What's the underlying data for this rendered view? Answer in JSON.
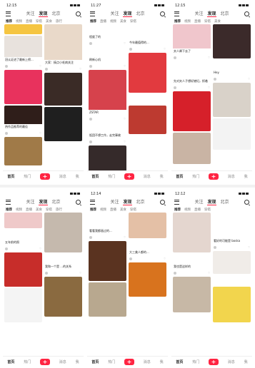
{
  "phones": [
    {
      "time": "12:15",
      "tabs": [
        "关注",
        "发现",
        "北京"
      ],
      "active_tab": "发现",
      "chips": [
        "推荐",
        "视频",
        "直播",
        "穿搭",
        "美食",
        "旅行"
      ],
      "bottom": [
        "首页",
        "热门",
        "+",
        "消息",
        "我"
      ],
      "left": [
        {
          "h": 14,
          "bg": "#f5c542",
          "cap": "",
          "user": ""
        },
        {
          "h": 30,
          "bg": "#e8e2dd",
          "cap": "冠认证进了最新上榜...",
          "user": ""
        },
        {
          "h": 48,
          "bg": "#e8325d",
          "cap": "",
          "user": ""
        },
        {
          "h": 26,
          "bg": "#2f1e1a",
          "cap": "热作品推荐的最佳",
          "user": ""
        },
        {
          "h": 40,
          "bg": "#a07a48",
          "cap": "",
          "user": ""
        }
      ],
      "right": [
        {
          "h": 50,
          "bg": "#e9d9c9",
          "cap": "大家：搞点小毛病关注",
          "user": ""
        },
        {
          "h": 46,
          "bg": "#3a2b26",
          "cap": "",
          "user": ""
        },
        {
          "h": 48,
          "bg": "#1f1f1f",
          "cap": "",
          "user": ""
        }
      ]
    },
    {
      "time": "11:27",
      "tabs": [
        "关注",
        "发现",
        "北京"
      ],
      "active_tab": "发现",
      "chips": [
        "推荐",
        "直播",
        "视频",
        "美食",
        "穿搭"
      ],
      "bottom": [
        "首页",
        "热门",
        "+",
        "消息",
        "我"
      ],
      "left": [
        {
          "h": 14,
          "bg": "#ffffff",
          "cap": "程度了的",
          "user": ""
        },
        {
          "h": 14,
          "bg": "#ffffff",
          "cap": "刷新心机",
          "user": ""
        },
        {
          "h": 56,
          "bg": "#d6424c",
          "cap": "ZSTAR",
          "user": ""
        },
        {
          "h": 14,
          "bg": "#ffffff",
          "cap": "饭团不想工作，走完事故",
          "user": ""
        },
        {
          "h": 38,
          "bg": "#352a2a",
          "cap": "",
          "user": ""
        }
      ],
      "right": [
        {
          "h": 22,
          "bg": "#ffffff",
          "cap": "今年最值得的...",
          "user": ""
        },
        {
          "h": 56,
          "bg": "#e23a3f",
          "cap": "",
          "user": ""
        },
        {
          "h": 14,
          "bg": "#ffffff",
          "cap": "",
          "user": ""
        },
        {
          "h": 40,
          "bg": "#bd3a30",
          "cap": "",
          "user": ""
        }
      ]
    },
    {
      "time": "12:15",
      "tabs": [
        "关注",
        "发现",
        "北京"
      ],
      "active_tab": "发现",
      "chips": [
        "推荐",
        "视频",
        "直播",
        "穿搭",
        "美食"
      ],
      "bottom": [
        "首页",
        "热门",
        "+",
        "消息",
        "我"
      ],
      "left": [
        {
          "h": 34,
          "bg": "#f0c6cc",
          "cap": "夫人卿下去了",
          "user": ""
        },
        {
          "h": 24,
          "bg": "#ffffff",
          "cap": "先对夫人子想好媳妇，抓着",
          "user": ""
        },
        {
          "h": 56,
          "bg": "#d6202a",
          "cap": "",
          "user": ""
        },
        {
          "h": 44,
          "bg": "#c9b4a4",
          "cap": "",
          "user": ""
        }
      ],
      "right": [
        {
          "h": 48,
          "bg": "#3b2a2a",
          "cap": "",
          "user": ""
        },
        {
          "h": 14,
          "bg": "#ffffff",
          "cap": "Hey",
          "user": ""
        },
        {
          "h": 48,
          "bg": "#d9d2c9",
          "cap": "",
          "user": ""
        },
        {
          "h": 44,
          "bg": "#f3f3f3",
          "cap": "",
          "user": ""
        }
      ]
    },
    {
      "time": "",
      "tabs": [
        "关注",
        "发现",
        "北京"
      ],
      "active_tab": "发现",
      "chips": [
        "推荐",
        "视频",
        "直播",
        "美食",
        "穿搭",
        "旅行"
      ],
      "bottom": [
        "首页",
        "热门",
        "+",
        "消息",
        "我"
      ],
      "left": [
        {
          "h": 22,
          "bg": "#efc9c9",
          "cap": "",
          "user": ""
        },
        {
          "h": 14,
          "bg": "#ffffff",
          "cap": "五年前的照",
          "user": ""
        },
        {
          "h": 48,
          "bg": "#c72d2a",
          "cap": "",
          "user": ""
        },
        {
          "h": 48,
          "bg": "#f4f4f4",
          "cap": "",
          "user": ""
        }
      ],
      "right": [
        {
          "h": 56,
          "bg": "#c5b9ad",
          "cap": "",
          "user": ""
        },
        {
          "h": 14,
          "bg": "#ffffff",
          "cap": "我和一个是 ...的关系",
          "user": ""
        },
        {
          "h": 56,
          "bg": "#8a6a40",
          "cap": "",
          "user": ""
        }
      ]
    },
    {
      "time": "12:14",
      "tabs": [
        "关注",
        "发现",
        "北京"
      ],
      "active_tab": "发现",
      "chips": [
        "推荐",
        "视频",
        "直播",
        "美食",
        "穿搭"
      ],
      "bottom": [
        "首页",
        "热门",
        "+",
        "消息",
        "我"
      ],
      "left": [
        {
          "h": 22,
          "bg": "#ffffff",
          "cap": "看看我都画过的...",
          "user": ""
        },
        {
          "h": 56,
          "bg": "#5a3320",
          "cap": "",
          "user": ""
        },
        {
          "h": 48,
          "bg": "#b8a88f",
          "cap": "",
          "user": ""
        }
      ],
      "right": [
        {
          "h": 36,
          "bg": "#e4c0a6",
          "cap": "",
          "user": ""
        },
        {
          "h": 14,
          "bg": "#ffffff",
          "cap": "大三美人都的...",
          "user": ""
        },
        {
          "h": 48,
          "bg": "#d8731e",
          "cap": "",
          "user": ""
        },
        {
          "h": 32,
          "bg": "#ffffff",
          "cap": "",
          "user": ""
        }
      ]
    },
    {
      "time": "12:12",
      "tabs": [
        "关注",
        "发现",
        "北京"
      ],
      "active_tab": "发现",
      "chips": [
        "推荐",
        "视频",
        "直播",
        "穿搭"
      ],
      "bottom": [
        "首页",
        "热门",
        "+",
        "消息",
        "我"
      ],
      "left": [
        {
          "h": 56,
          "bg": "#e4d6cf",
          "cap": "",
          "user": ""
        },
        {
          "h": 14,
          "bg": "#ffffff",
          "cap": "我也是这样的",
          "user": ""
        },
        {
          "h": 50,
          "bg": "#c7b8a6",
          "cap": "",
          "user": ""
        },
        {
          "h": 14,
          "bg": "#ffffff",
          "cap": "",
          "user": ""
        }
      ],
      "right": [
        {
          "h": 36,
          "bg": "#ffffff",
          "cap": "看好的可能是 boska",
          "user": ""
        },
        {
          "h": 32,
          "bg": "#f0ece8",
          "cap": "",
          "user": ""
        },
        {
          "h": 14,
          "bg": "#ffffff",
          "cap": "",
          "user": ""
        },
        {
          "h": 50,
          "bg": "#f2d54d",
          "cap": "",
          "user": ""
        }
      ]
    }
  ]
}
